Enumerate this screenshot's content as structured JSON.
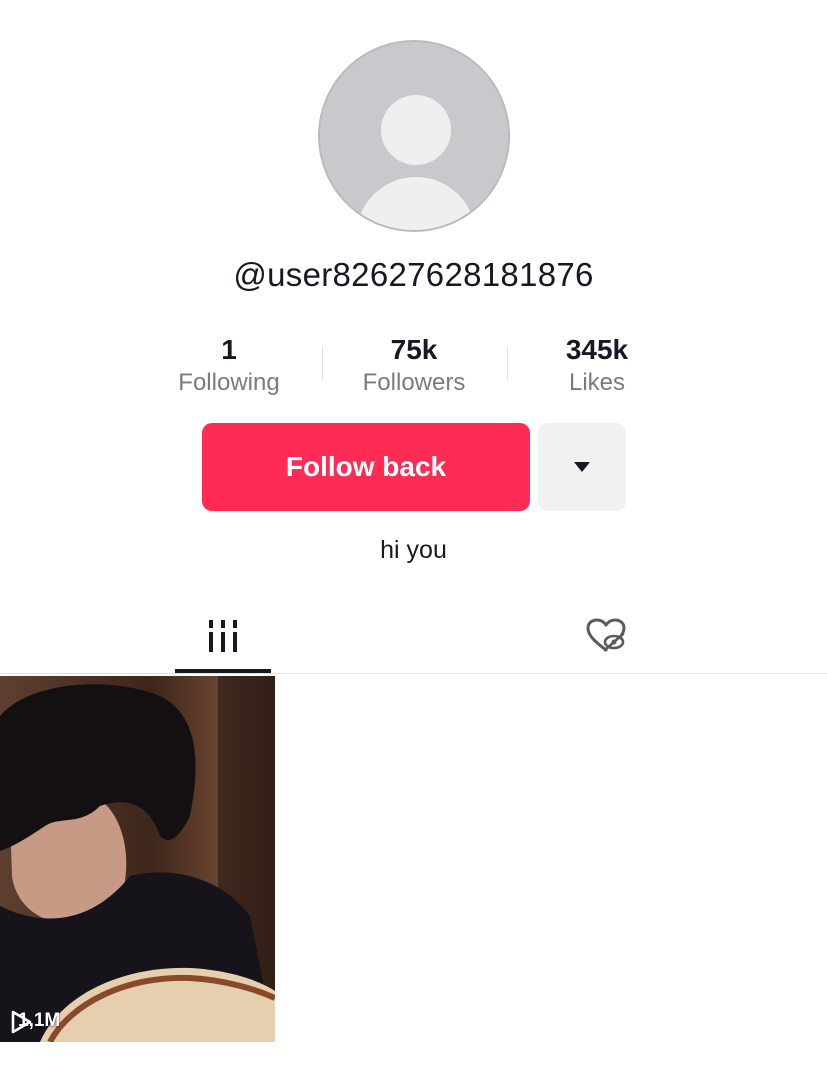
{
  "profile": {
    "username": "@user82627628181876",
    "bio": "hi you"
  },
  "stats": {
    "following": {
      "value": "1",
      "label": "Following"
    },
    "followers": {
      "value": "75k",
      "label": "Followers"
    },
    "likes": {
      "value": "345k",
      "label": "Likes"
    }
  },
  "actions": {
    "follow_label": "Follow back"
  },
  "tabs": [
    {
      "name": "videos",
      "icon": "grid-icon",
      "active": true
    },
    {
      "name": "liked",
      "icon": "heart-hidden-icon",
      "active": false
    }
  ],
  "videos": [
    {
      "views": "1,1M"
    }
  ],
  "colors": {
    "accent": "#fe2c55",
    "text": "#161823",
    "secondary_text": "#7a7b80"
  }
}
